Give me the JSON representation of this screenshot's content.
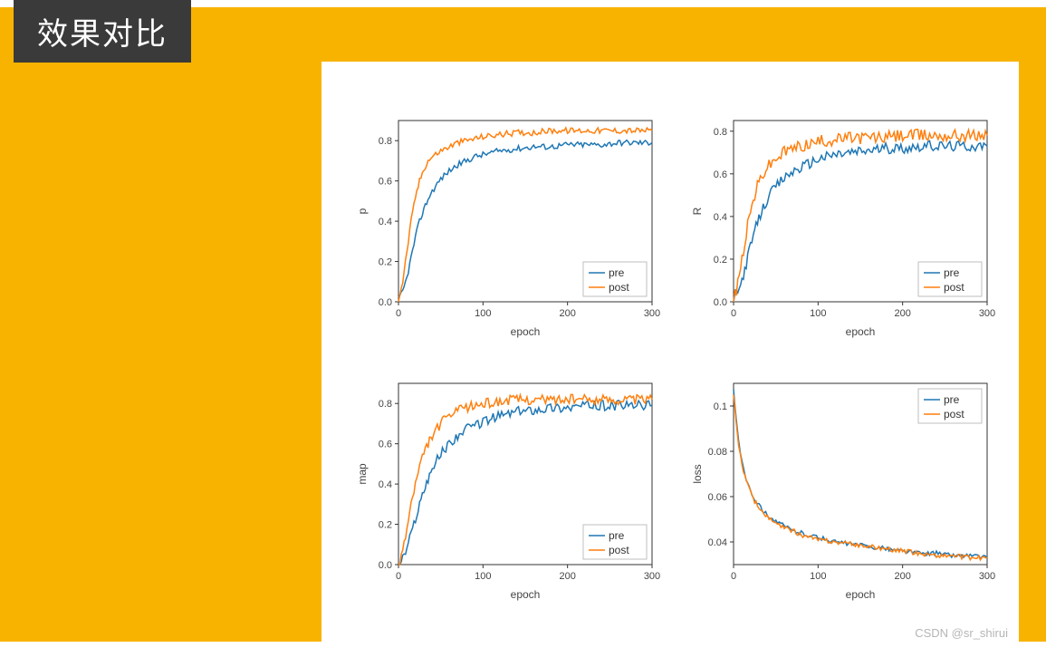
{
  "title": "效果对比",
  "watermark": "CSDN @sr_shirui",
  "legend": {
    "pre": "pre",
    "post": "post"
  },
  "xlabel": "epoch",
  "chart_data": [
    {
      "type": "line",
      "title": "",
      "xlabel": "epoch",
      "ylabel": "p",
      "xlim": [
        0,
        300
      ],
      "ylim": [
        0.0,
        0.9
      ],
      "x_ticks": [
        0,
        100,
        200,
        300
      ],
      "y_ticks": [
        0.0,
        0.2,
        0.4,
        0.6,
        0.8
      ],
      "series": [
        {
          "name": "pre",
          "x": [
            0,
            5,
            10,
            15,
            20,
            25,
            30,
            35,
            40,
            50,
            60,
            70,
            80,
            90,
            100,
            120,
            140,
            160,
            180,
            200,
            220,
            240,
            260,
            280,
            300
          ],
          "y": [
            0.01,
            0.05,
            0.12,
            0.22,
            0.32,
            0.4,
            0.46,
            0.51,
            0.55,
            0.61,
            0.65,
            0.68,
            0.7,
            0.72,
            0.73,
            0.75,
            0.76,
            0.77,
            0.77,
            0.78,
            0.78,
            0.78,
            0.79,
            0.79,
            0.79
          ],
          "noise": 0.03
        },
        {
          "name": "post",
          "x": [
            0,
            5,
            10,
            15,
            20,
            25,
            30,
            35,
            40,
            50,
            60,
            70,
            80,
            90,
            100,
            120,
            140,
            160,
            180,
            200,
            220,
            240,
            260,
            280,
            300
          ],
          "y": [
            0.01,
            0.1,
            0.25,
            0.4,
            0.52,
            0.6,
            0.66,
            0.7,
            0.72,
            0.75,
            0.77,
            0.79,
            0.8,
            0.81,
            0.82,
            0.83,
            0.84,
            0.84,
            0.85,
            0.85,
            0.85,
            0.85,
            0.85,
            0.85,
            0.85
          ],
          "noise": 0.03
        }
      ],
      "legend_pos": "lower-right"
    },
    {
      "type": "line",
      "title": "",
      "xlabel": "epoch",
      "ylabel": "R",
      "xlim": [
        0,
        300
      ],
      "ylim": [
        0.0,
        0.85
      ],
      "x_ticks": [
        0,
        100,
        200,
        300
      ],
      "y_ticks": [
        0.0,
        0.2,
        0.4,
        0.6,
        0.8
      ],
      "series": [
        {
          "name": "pre",
          "x": [
            0,
            5,
            10,
            15,
            20,
            25,
            30,
            35,
            40,
            50,
            60,
            70,
            80,
            90,
            100,
            120,
            140,
            160,
            180,
            200,
            220,
            240,
            260,
            280,
            300
          ],
          "y": [
            0.01,
            0.04,
            0.1,
            0.18,
            0.26,
            0.33,
            0.39,
            0.44,
            0.48,
            0.54,
            0.58,
            0.61,
            0.63,
            0.65,
            0.67,
            0.69,
            0.7,
            0.71,
            0.72,
            0.72,
            0.73,
            0.73,
            0.73,
            0.73,
            0.73
          ],
          "noise": 0.05
        },
        {
          "name": "post",
          "x": [
            0,
            5,
            10,
            15,
            20,
            25,
            30,
            35,
            40,
            50,
            60,
            70,
            80,
            90,
            100,
            120,
            140,
            160,
            180,
            200,
            220,
            240,
            260,
            280,
            300
          ],
          "y": [
            0.01,
            0.08,
            0.2,
            0.32,
            0.42,
            0.5,
            0.56,
            0.6,
            0.63,
            0.67,
            0.7,
            0.72,
            0.73,
            0.74,
            0.75,
            0.76,
            0.77,
            0.77,
            0.77,
            0.78,
            0.78,
            0.78,
            0.78,
            0.78,
            0.78
          ],
          "noise": 0.06
        }
      ],
      "legend_pos": "lower-right"
    },
    {
      "type": "line",
      "title": "",
      "xlabel": "epoch",
      "ylabel": "map",
      "xlim": [
        0,
        300
      ],
      "ylim": [
        0.0,
        0.9
      ],
      "x_ticks": [
        0,
        100,
        200,
        300
      ],
      "y_ticks": [
        0.0,
        0.2,
        0.4,
        0.6,
        0.8
      ],
      "series": [
        {
          "name": "pre",
          "x": [
            0,
            5,
            10,
            15,
            20,
            25,
            30,
            35,
            40,
            50,
            60,
            70,
            80,
            90,
            100,
            120,
            140,
            160,
            180,
            200,
            220,
            240,
            260,
            280,
            300
          ],
          "y": [
            0.0,
            0.03,
            0.08,
            0.15,
            0.23,
            0.3,
            0.37,
            0.43,
            0.48,
            0.55,
            0.6,
            0.64,
            0.67,
            0.69,
            0.71,
            0.74,
            0.76,
            0.77,
            0.78,
            0.78,
            0.79,
            0.79,
            0.79,
            0.79,
            0.79
          ],
          "noise": 0.05
        },
        {
          "name": "post",
          "x": [
            0,
            5,
            10,
            15,
            20,
            25,
            30,
            35,
            40,
            50,
            60,
            70,
            80,
            90,
            100,
            120,
            140,
            160,
            180,
            200,
            220,
            240,
            260,
            280,
            300
          ],
          "y": [
            0.0,
            0.07,
            0.18,
            0.3,
            0.4,
            0.48,
            0.55,
            0.6,
            0.64,
            0.7,
            0.74,
            0.76,
            0.78,
            0.79,
            0.8,
            0.81,
            0.82,
            0.82,
            0.82,
            0.82,
            0.82,
            0.82,
            0.82,
            0.82,
            0.82
          ],
          "noise": 0.05
        }
      ],
      "legend_pos": "lower-right"
    },
    {
      "type": "line",
      "title": "",
      "xlabel": "epoch",
      "ylabel": "loss",
      "xlim": [
        0,
        300
      ],
      "ylim": [
        0.03,
        0.11
      ],
      "x_ticks": [
        0,
        100,
        200,
        300
      ],
      "y_ticks": [
        0.04,
        0.06,
        0.08,
        0.1
      ],
      "series": [
        {
          "name": "pre",
          "x": [
            0,
            3,
            6,
            10,
            15,
            20,
            25,
            30,
            40,
            50,
            60,
            70,
            80,
            90,
            100,
            120,
            140,
            160,
            180,
            200,
            220,
            240,
            260,
            280,
            300
          ],
          "y": [
            0.108,
            0.095,
            0.085,
            0.075,
            0.068,
            0.063,
            0.059,
            0.056,
            0.052,
            0.049,
            0.047,
            0.045,
            0.044,
            0.043,
            0.042,
            0.04,
            0.039,
            0.038,
            0.037,
            0.036,
            0.035,
            0.035,
            0.034,
            0.034,
            0.033
          ],
          "noise": 0.002
        },
        {
          "name": "post",
          "x": [
            0,
            3,
            6,
            10,
            15,
            20,
            25,
            30,
            40,
            50,
            60,
            70,
            80,
            90,
            100,
            120,
            140,
            160,
            180,
            200,
            220,
            240,
            260,
            280,
            300
          ],
          "y": [
            0.106,
            0.093,
            0.083,
            0.074,
            0.067,
            0.062,
            0.058,
            0.055,
            0.051,
            0.048,
            0.046,
            0.045,
            0.043,
            0.042,
            0.041,
            0.04,
            0.039,
            0.038,
            0.037,
            0.036,
            0.035,
            0.034,
            0.034,
            0.033,
            0.033
          ],
          "noise": 0.002
        }
      ],
      "legend_pos": "upper-right"
    }
  ]
}
